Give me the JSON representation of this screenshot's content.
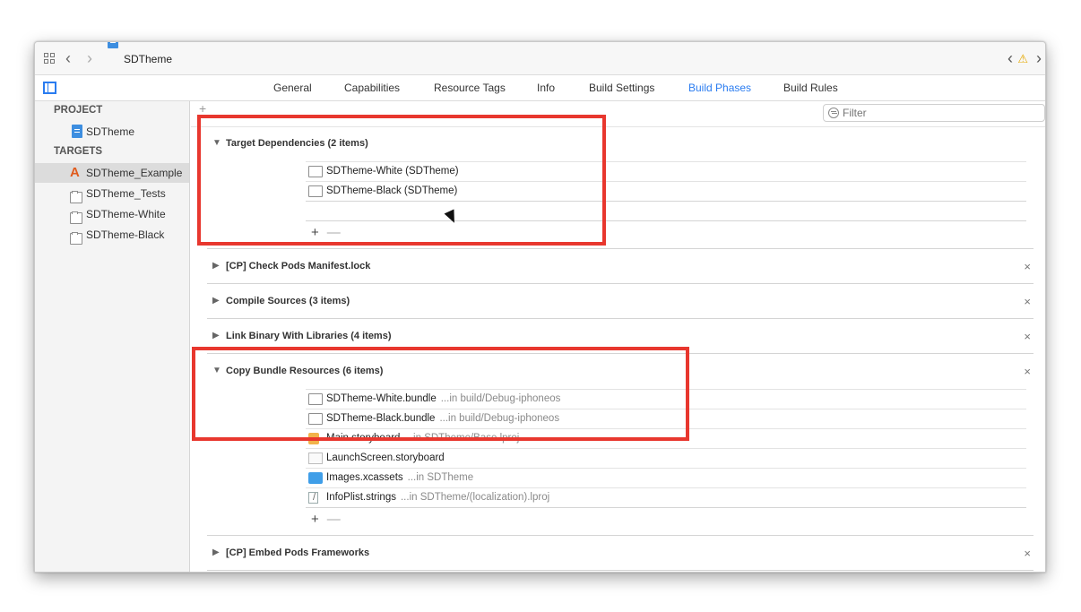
{
  "jumpbar": {
    "title": "SDTheme",
    "back_glyph": "‹",
    "forward_glyph": "›",
    "right_back_glyph": "‹",
    "right_forward_glyph": "›",
    "warning_glyph": "⚠"
  },
  "tabs": [
    "General",
    "Capabilities",
    "Resource Tags",
    "Info",
    "Build Settings",
    "Build Phases",
    "Build Rules"
  ],
  "active_tab": "Build Phases",
  "sidebar": {
    "project_header": "PROJECT",
    "project_name": "SDTheme",
    "targets_header": "TARGETS",
    "targets": [
      "SDTheme_Example",
      "SDTheme_Tests",
      "SDTheme-White",
      "SDTheme-Black"
    ],
    "selected_target": "SDTheme_Example"
  },
  "toolbar": {
    "add_label": "+",
    "filter_placeholder": "Filter"
  },
  "phases": {
    "target_dependencies": {
      "title": "Target Dependencies (2 items)",
      "items": [
        "SDTheme-White (SDTheme)",
        "SDTheme-Black (SDTheme)"
      ]
    },
    "check_pods": {
      "title": "[CP] Check Pods Manifest.lock"
    },
    "compile_sources": {
      "title": "Compile Sources (3 items)"
    },
    "link_binary": {
      "title": "Link Binary With Libraries (4 items)"
    },
    "copy_bundle": {
      "title": "Copy Bundle Resources (6 items)",
      "items": [
        {
          "name": "SDTheme-White.bundle",
          "location": "...in build/Debug-iphoneos"
        },
        {
          "name": "SDTheme-Black.bundle",
          "location": "...in build/Debug-iphoneos"
        },
        {
          "name": "Main.storyboard",
          "location": "...in SDTheme/Base.lproj"
        },
        {
          "name": "LaunchScreen.storyboard",
          "location": ""
        },
        {
          "name": "Images.xcassets",
          "location": "...in SDTheme"
        },
        {
          "name": "InfoPlist.strings",
          "location": "...in SDTheme/(localization).lproj"
        }
      ]
    },
    "embed_pods": {
      "title": "[CP] Embed Pods Frameworks"
    }
  },
  "glyphs": {
    "expanded": "▼",
    "collapsed": "▶",
    "close": "×",
    "plus": "+",
    "minus": "—"
  },
  "highlight_color": "#e8372e",
  "accent_color": "#2a7cf0"
}
